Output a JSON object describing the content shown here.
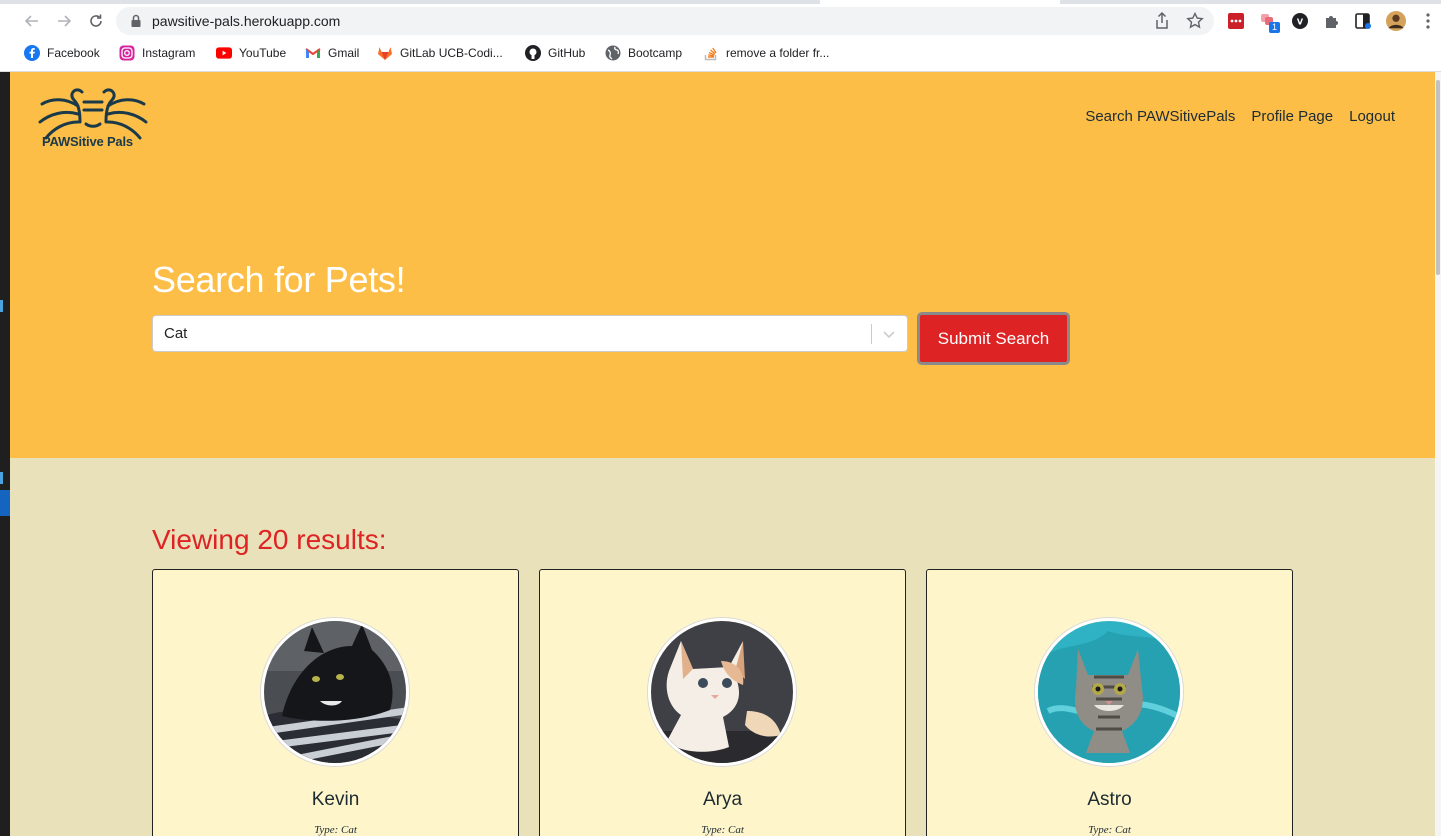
{
  "browser": {
    "url": "pawsitive-pals.herokuapp.com",
    "extension_badge": "1",
    "bookmarks": [
      {
        "label": "Facebook",
        "icon": "facebook-icon"
      },
      {
        "label": "Instagram",
        "icon": "instagram-icon"
      },
      {
        "label": "YouTube",
        "icon": "youtube-icon"
      },
      {
        "label": "Gmail",
        "icon": "gmail-icon"
      },
      {
        "label": "GitLab UCB-Codi...",
        "icon": "gitlab-icon"
      },
      {
        "label": "GitHub",
        "icon": "github-icon"
      },
      {
        "label": "Bootcamp",
        "icon": "globe-icon"
      },
      {
        "label": "remove a folder fr...",
        "icon": "stackoverflow-icon"
      }
    ]
  },
  "site": {
    "logo_text": "PAWSitive Pals",
    "nav": [
      "Search PAWSitivePals",
      "Profile Page",
      "Logout"
    ]
  },
  "search": {
    "heading": "Search for Pets!",
    "selected": "Cat",
    "submit_label": "Submit Search"
  },
  "results": {
    "title": "Viewing 20 results:",
    "cards": [
      {
        "name": "Kevin",
        "type": "Type: Cat"
      },
      {
        "name": "Arya",
        "type": "Type: Cat"
      },
      {
        "name": "Astro",
        "type": "Type: Cat"
      }
    ]
  },
  "colors": {
    "hero": "#fdbe48",
    "body": "#e9e1b9",
    "card": "#fff5cb",
    "accent_red": "#dd2323",
    "text_dark": "#1d2b33"
  }
}
